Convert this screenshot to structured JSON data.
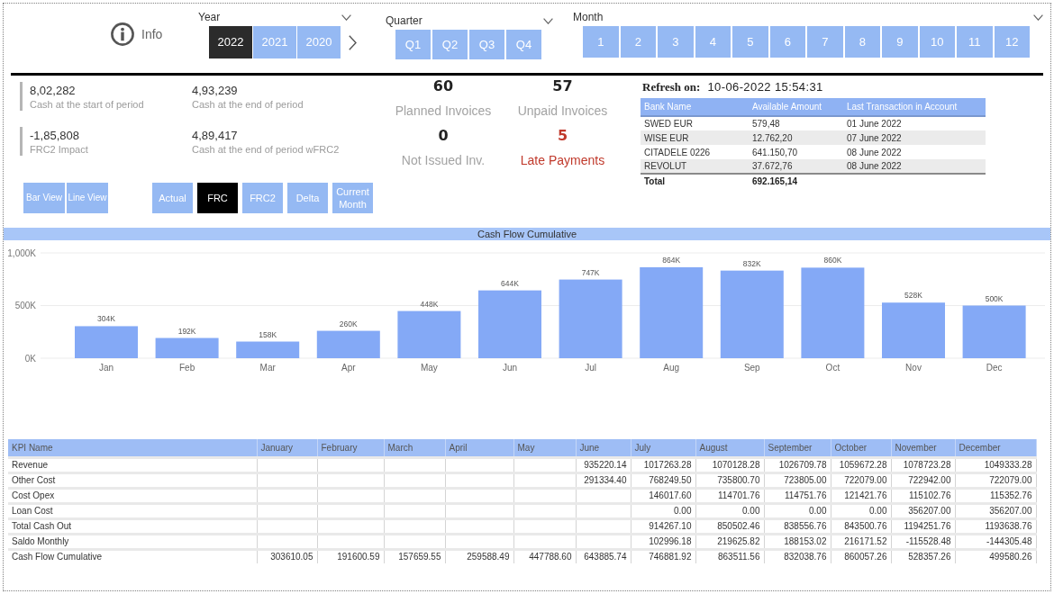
{
  "info": {
    "label": "Info"
  },
  "slicers": {
    "year": {
      "title": "Year",
      "options": [
        {
          "label": "2022",
          "selected": true
        },
        {
          "label": "2021",
          "selected": false
        },
        {
          "label": "2020",
          "selected": false
        }
      ]
    },
    "quarter": {
      "title": "Quarter",
      "options": [
        {
          "label": "Q1",
          "selected": false
        },
        {
          "label": "Q2",
          "selected": false
        },
        {
          "label": "Q3",
          "selected": false
        },
        {
          "label": "Q4",
          "selected": false
        }
      ]
    },
    "month": {
      "title": "Month",
      "options": [
        {
          "label": "1",
          "selected": false
        },
        {
          "label": "2",
          "selected": false
        },
        {
          "label": "3",
          "selected": false
        },
        {
          "label": "4",
          "selected": false
        },
        {
          "label": "5",
          "selected": false
        },
        {
          "label": "6",
          "selected": false
        },
        {
          "label": "7",
          "selected": false
        },
        {
          "label": "8",
          "selected": false
        },
        {
          "label": "9",
          "selected": false
        },
        {
          "label": "10",
          "selected": false
        },
        {
          "label": "11",
          "selected": false
        },
        {
          "label": "12",
          "selected": false
        }
      ]
    }
  },
  "kpis": [
    {
      "value": "8,02,282",
      "label": "Cash at the start of period"
    },
    {
      "value": "4,93,239",
      "label": "Cash at the end of period"
    },
    {
      "value": "-1,85,808",
      "label": "FRC2 Impact"
    },
    {
      "value": "4,89,417",
      "label": "Cash at the end of period wFRC2"
    }
  ],
  "invoice_cards": [
    {
      "count": "60",
      "label": "Planned Invoices",
      "alert": false
    },
    {
      "count": "57",
      "label": "Unpaid Invoices",
      "alert": false
    },
    {
      "count": "0",
      "label": "Not Issued Inv.",
      "alert": false
    },
    {
      "count": "5",
      "label": "Late Payments",
      "alert": true
    }
  ],
  "view_buttons": [
    {
      "label": "Bar View",
      "selected": false
    },
    {
      "label": "Line View",
      "selected": false
    }
  ],
  "measure_buttons": [
    {
      "label": "Actual",
      "selected": false
    },
    {
      "label": "FRC",
      "selected": true
    },
    {
      "label": "FRC2",
      "selected": false
    },
    {
      "label": "Delta",
      "selected": false
    },
    {
      "label": "Current Month",
      "selected": false
    }
  ],
  "refresh": {
    "label": "Refresh on:",
    "value": "10-06-2022 15:54:31"
  },
  "bank_table": {
    "columns": [
      "Bank Name",
      "Available Amount",
      "Last Transaction in Account"
    ],
    "rows": [
      [
        "SWED EUR",
        "579,48",
        "01 June 2022"
      ],
      [
        "WISE EUR",
        "12.762,20",
        "07 June 2022"
      ],
      [
        "CITADELE 0226",
        "641.150,70",
        "08 June 2022"
      ],
      [
        "REVOLUT",
        "37.672,76",
        "08 June 2022"
      ]
    ],
    "total": {
      "label": "Total",
      "amount": "692.165,14"
    }
  },
  "chart": {
    "chart_data": {
      "type": "bar",
      "title": "Cash Flow Cumulative",
      "categories": [
        "Jan",
        "Feb",
        "Mar",
        "Apr",
        "May",
        "Jun",
        "Jul",
        "Aug",
        "Sep",
        "Oct",
        "Nov",
        "Dec"
      ],
      "series": [
        {
          "color": "#84a9f6",
          "values": [
            304,
            192,
            158,
            260,
            448,
            644,
            747,
            864,
            832,
            860,
            528,
            500
          ]
        }
      ],
      "ylim": [
        0,
        1000
      ],
      "yticks": [
        {
          "value": 0,
          "label": "0K"
        },
        {
          "value": 500,
          "label": "500K"
        },
        {
          "value": 1000,
          "label": "1,000K"
        }
      ],
      "value_labels": [
        "304K",
        "192K",
        "158K",
        "260K",
        "448K",
        "644K",
        "747K",
        "864K",
        "832K",
        "860K",
        "528K",
        "500K"
      ]
    }
  },
  "kpi_table": {
    "columns": [
      "KPI Name",
      "January",
      "February",
      "March",
      "April",
      "May",
      "June",
      "July",
      "August",
      "September",
      "October",
      "November",
      "December"
    ],
    "rows": [
      {
        "name": "Revenue",
        "values": [
          "935220.14",
          "1017263.28",
          "1070128.28",
          "1026709.78",
          "1059672.28",
          "1078723.28",
          "1049333.28"
        ]
      },
      {
        "name": "Other Cost",
        "values": [
          "291334.40",
          "768249.50",
          "735800.70",
          "723805.00",
          "722079.00",
          "722942.00",
          "722079.00"
        ]
      },
      {
        "name": "Cost Opex",
        "values": [
          "146017.60",
          "114701.76",
          "114751.76",
          "121421.76",
          "115102.76",
          "115352.76"
        ]
      },
      {
        "name": "Loan Cost",
        "values": [
          "0.00",
          "0.00",
          "0.00",
          "0.00",
          "356207.00",
          "356207.00"
        ]
      },
      {
        "name": "Total Cash Out",
        "values": [
          "914267.10",
          "850502.46",
          "838556.76",
          "843500.76",
          "1194251.76",
          "1193638.76"
        ]
      },
      {
        "name": "Saldo Monthly",
        "values": [
          "102996.18",
          "219625.82",
          "188153.02",
          "216171.52",
          "-115528.48",
          "-144305.48"
        ]
      },
      {
        "name": "Cash Flow Cumulative",
        "values": [
          "303610.05",
          "191600.59",
          "157659.55",
          "259588.49",
          "447788.60",
          "643885.74",
          "746881.92",
          "863511.56",
          "832038.76",
          "860057.26",
          "528357.26",
          "499580.26"
        ]
      }
    ]
  }
}
